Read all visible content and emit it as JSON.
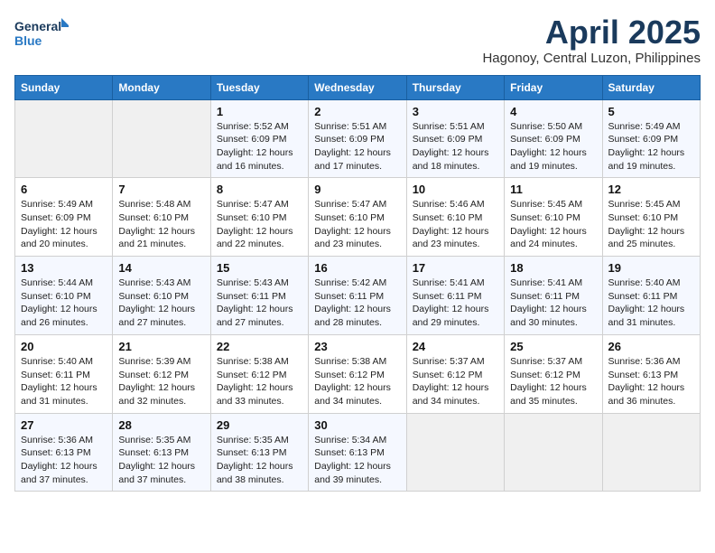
{
  "logo": {
    "line1": "General",
    "line2": "Blue"
  },
  "title": "April 2025",
  "subtitle": "Hagonoy, Central Luzon, Philippines",
  "days_of_week": [
    "Sunday",
    "Monday",
    "Tuesday",
    "Wednesday",
    "Thursday",
    "Friday",
    "Saturday"
  ],
  "weeks": [
    [
      {
        "day": "",
        "info": ""
      },
      {
        "day": "",
        "info": ""
      },
      {
        "day": "1",
        "info": "Sunrise: 5:52 AM\nSunset: 6:09 PM\nDaylight: 12 hours and 16 minutes."
      },
      {
        "day": "2",
        "info": "Sunrise: 5:51 AM\nSunset: 6:09 PM\nDaylight: 12 hours and 17 minutes."
      },
      {
        "day": "3",
        "info": "Sunrise: 5:51 AM\nSunset: 6:09 PM\nDaylight: 12 hours and 18 minutes."
      },
      {
        "day": "4",
        "info": "Sunrise: 5:50 AM\nSunset: 6:09 PM\nDaylight: 12 hours and 19 minutes."
      },
      {
        "day": "5",
        "info": "Sunrise: 5:49 AM\nSunset: 6:09 PM\nDaylight: 12 hours and 19 minutes."
      }
    ],
    [
      {
        "day": "6",
        "info": "Sunrise: 5:49 AM\nSunset: 6:09 PM\nDaylight: 12 hours and 20 minutes."
      },
      {
        "day": "7",
        "info": "Sunrise: 5:48 AM\nSunset: 6:10 PM\nDaylight: 12 hours and 21 minutes."
      },
      {
        "day": "8",
        "info": "Sunrise: 5:47 AM\nSunset: 6:10 PM\nDaylight: 12 hours and 22 minutes."
      },
      {
        "day": "9",
        "info": "Sunrise: 5:47 AM\nSunset: 6:10 PM\nDaylight: 12 hours and 23 minutes."
      },
      {
        "day": "10",
        "info": "Sunrise: 5:46 AM\nSunset: 6:10 PM\nDaylight: 12 hours and 23 minutes."
      },
      {
        "day": "11",
        "info": "Sunrise: 5:45 AM\nSunset: 6:10 PM\nDaylight: 12 hours and 24 minutes."
      },
      {
        "day": "12",
        "info": "Sunrise: 5:45 AM\nSunset: 6:10 PM\nDaylight: 12 hours and 25 minutes."
      }
    ],
    [
      {
        "day": "13",
        "info": "Sunrise: 5:44 AM\nSunset: 6:10 PM\nDaylight: 12 hours and 26 minutes."
      },
      {
        "day": "14",
        "info": "Sunrise: 5:43 AM\nSunset: 6:10 PM\nDaylight: 12 hours and 27 minutes."
      },
      {
        "day": "15",
        "info": "Sunrise: 5:43 AM\nSunset: 6:11 PM\nDaylight: 12 hours and 27 minutes."
      },
      {
        "day": "16",
        "info": "Sunrise: 5:42 AM\nSunset: 6:11 PM\nDaylight: 12 hours and 28 minutes."
      },
      {
        "day": "17",
        "info": "Sunrise: 5:41 AM\nSunset: 6:11 PM\nDaylight: 12 hours and 29 minutes."
      },
      {
        "day": "18",
        "info": "Sunrise: 5:41 AM\nSunset: 6:11 PM\nDaylight: 12 hours and 30 minutes."
      },
      {
        "day": "19",
        "info": "Sunrise: 5:40 AM\nSunset: 6:11 PM\nDaylight: 12 hours and 31 minutes."
      }
    ],
    [
      {
        "day": "20",
        "info": "Sunrise: 5:40 AM\nSunset: 6:11 PM\nDaylight: 12 hours and 31 minutes."
      },
      {
        "day": "21",
        "info": "Sunrise: 5:39 AM\nSunset: 6:12 PM\nDaylight: 12 hours and 32 minutes."
      },
      {
        "day": "22",
        "info": "Sunrise: 5:38 AM\nSunset: 6:12 PM\nDaylight: 12 hours and 33 minutes."
      },
      {
        "day": "23",
        "info": "Sunrise: 5:38 AM\nSunset: 6:12 PM\nDaylight: 12 hours and 34 minutes."
      },
      {
        "day": "24",
        "info": "Sunrise: 5:37 AM\nSunset: 6:12 PM\nDaylight: 12 hours and 34 minutes."
      },
      {
        "day": "25",
        "info": "Sunrise: 5:37 AM\nSunset: 6:12 PM\nDaylight: 12 hours and 35 minutes."
      },
      {
        "day": "26",
        "info": "Sunrise: 5:36 AM\nSunset: 6:13 PM\nDaylight: 12 hours and 36 minutes."
      }
    ],
    [
      {
        "day": "27",
        "info": "Sunrise: 5:36 AM\nSunset: 6:13 PM\nDaylight: 12 hours and 37 minutes."
      },
      {
        "day": "28",
        "info": "Sunrise: 5:35 AM\nSunset: 6:13 PM\nDaylight: 12 hours and 37 minutes."
      },
      {
        "day": "29",
        "info": "Sunrise: 5:35 AM\nSunset: 6:13 PM\nDaylight: 12 hours and 38 minutes."
      },
      {
        "day": "30",
        "info": "Sunrise: 5:34 AM\nSunset: 6:13 PM\nDaylight: 12 hours and 39 minutes."
      },
      {
        "day": "",
        "info": ""
      },
      {
        "day": "",
        "info": ""
      },
      {
        "day": "",
        "info": ""
      }
    ]
  ]
}
